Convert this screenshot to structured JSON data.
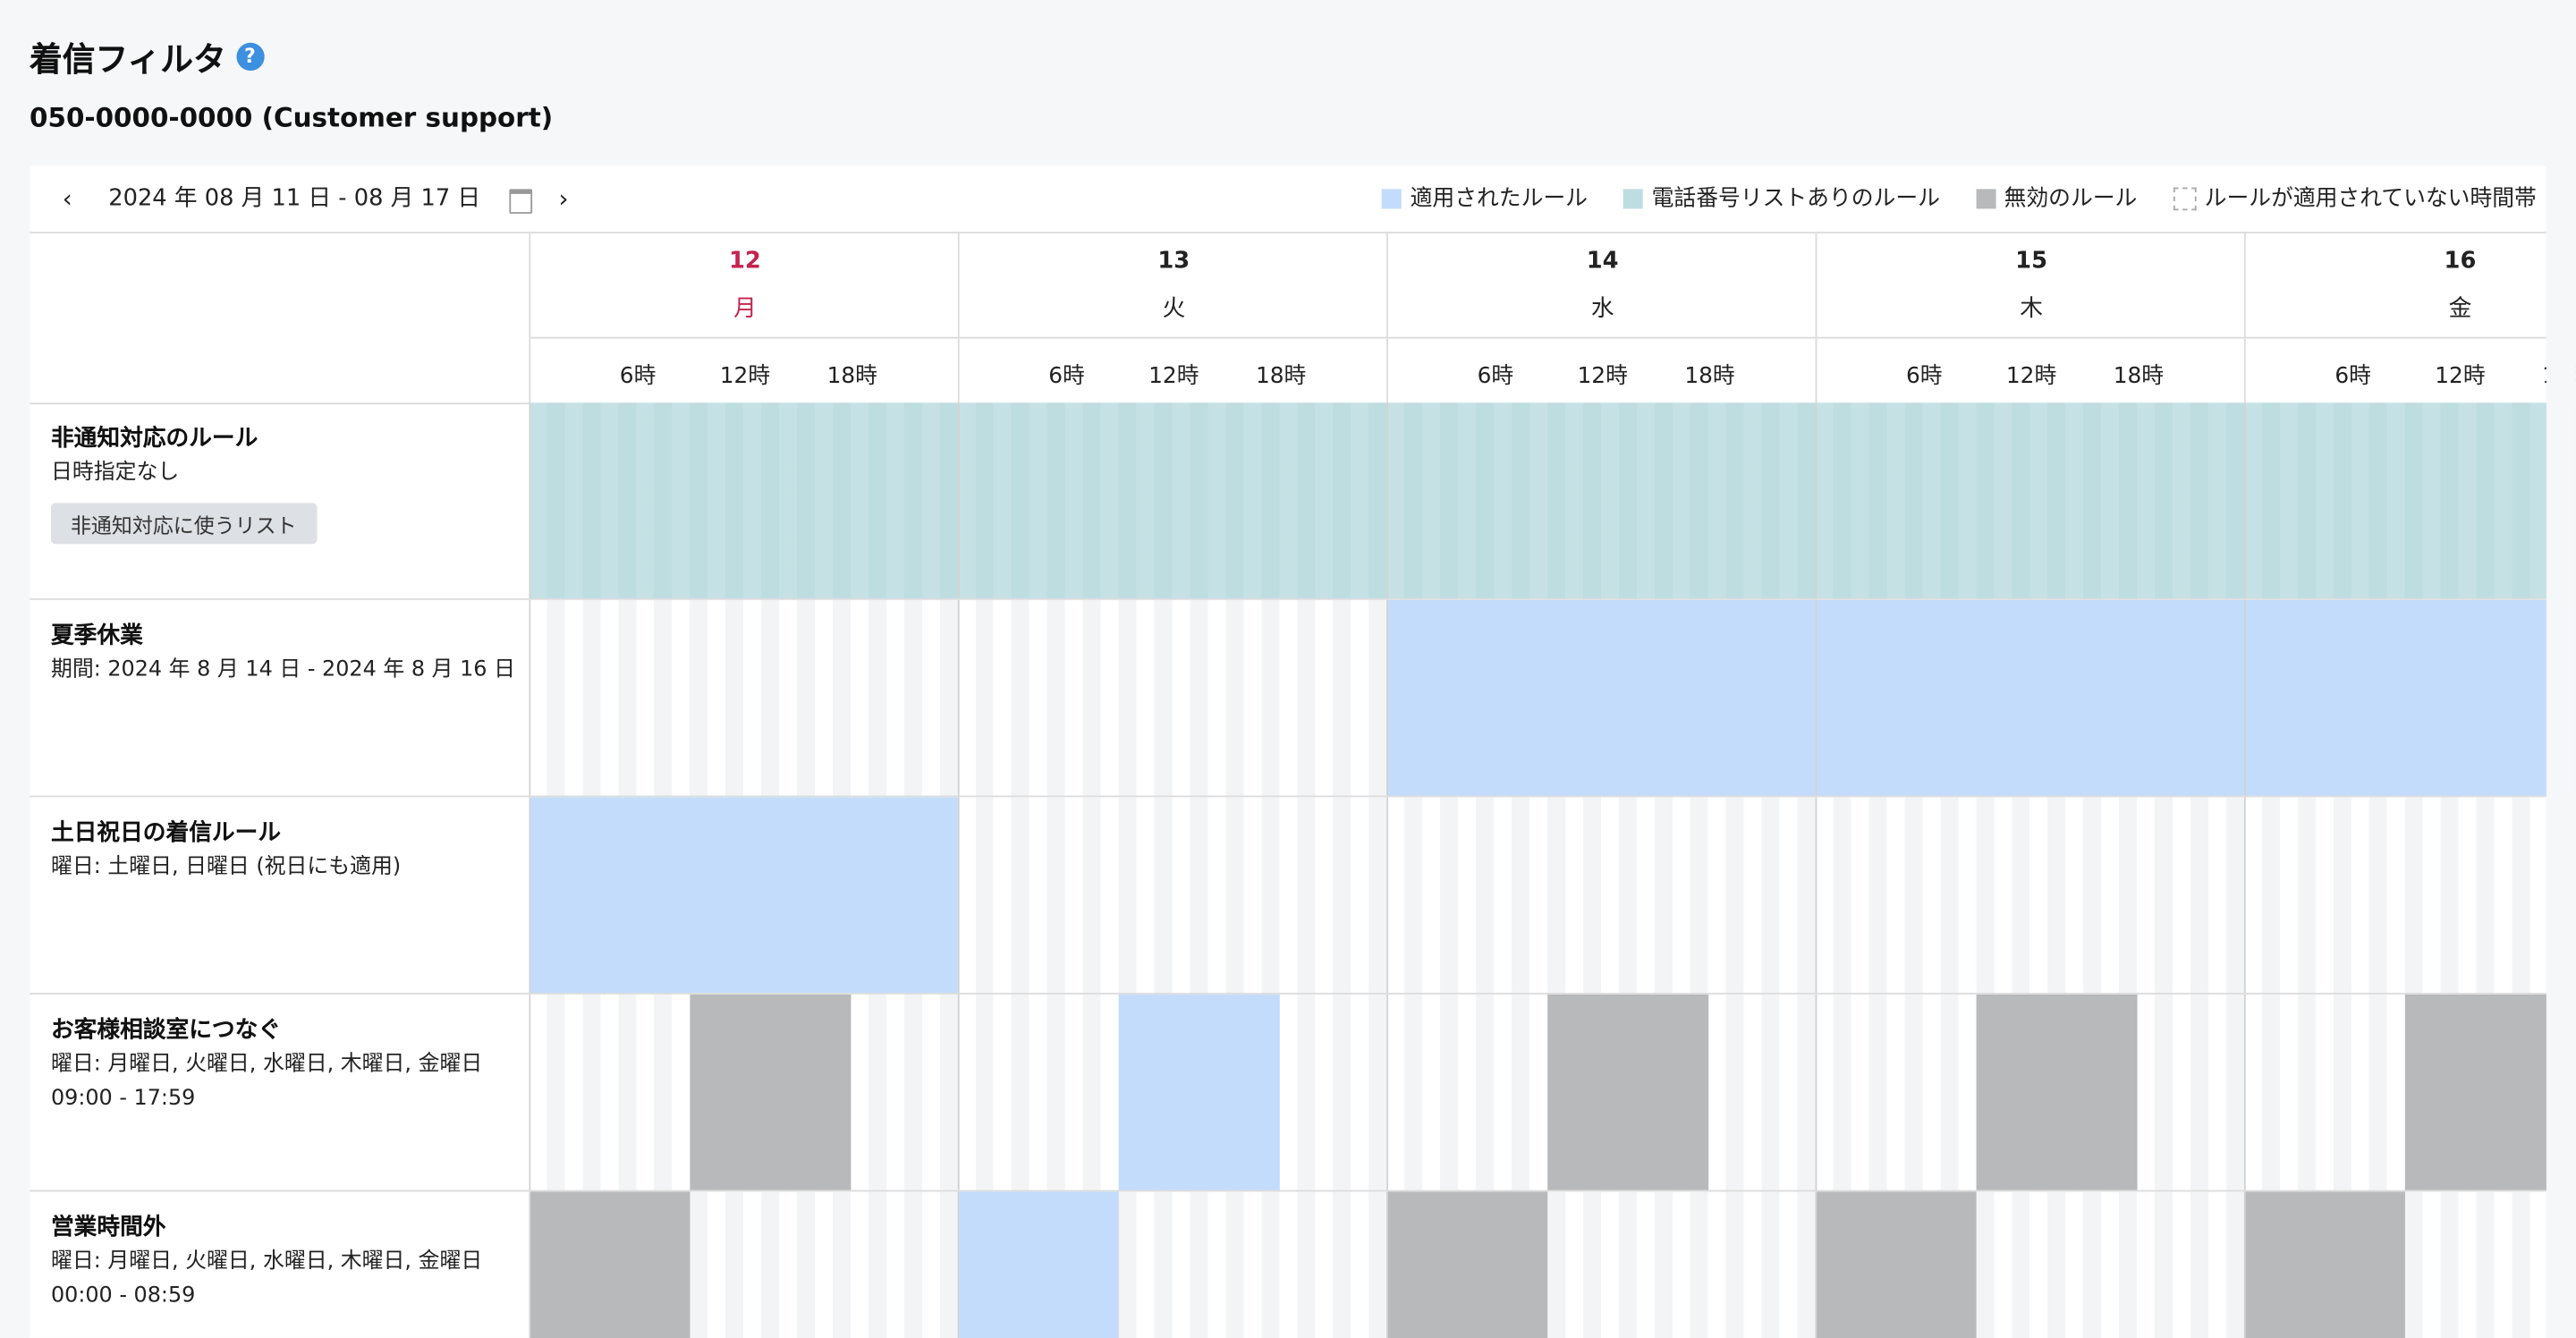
{
  "page": {
    "title": "着信フィルタ",
    "help_icon": "help-circle-icon",
    "phone_line": "050-0000-0000 (Customer support)"
  },
  "toolbar": {
    "prev_label": "‹",
    "next_label": "›",
    "date_range": "2024 年 08 月 11 日 - 08 月 17 日",
    "calendar_icon": "calendar-icon"
  },
  "legend": [
    {
      "label": "適用されたルール",
      "color": "#c3dcfb",
      "kind": "applied"
    },
    {
      "label": "電話番号リストありのルール",
      "color": "#bedde1",
      "kind": "list"
    },
    {
      "label": "無効のルール",
      "color": "#b8b9bb",
      "kind": "disabled"
    },
    {
      "label": "ルールが適用されていない時間帯",
      "color": "#ffffff",
      "kind": "none"
    }
  ],
  "hour_labels": [
    "6時",
    "12時",
    "18時"
  ],
  "days": [
    {
      "num": "12",
      "weekday": "月",
      "highlight": true
    },
    {
      "num": "13",
      "weekday": "火",
      "highlight": false
    },
    {
      "num": "14",
      "weekday": "水",
      "highlight": false
    },
    {
      "num": "15",
      "weekday": "木",
      "highlight": false
    },
    {
      "num": "16",
      "weekday": "金",
      "highlight": false
    }
  ],
  "colors": {
    "highlight_day": "#c4234f",
    "applied": "#c3dcfb",
    "list": "#bedde1",
    "disabled": "#b8b9bb"
  },
  "rules": [
    {
      "name": "非通知対応のルール",
      "details": [
        "日時指定なし"
      ],
      "tag": "非通知対応に使うリスト",
      "blocks": [
        {
          "day": 0,
          "from": 0,
          "to": 24,
          "type": "list"
        },
        {
          "day": 1,
          "from": 0,
          "to": 24,
          "type": "list"
        },
        {
          "day": 2,
          "from": 0,
          "to": 24,
          "type": "list"
        },
        {
          "day": 3,
          "from": 0,
          "to": 24,
          "type": "list"
        },
        {
          "day": 4,
          "from": 0,
          "to": 24,
          "type": "list"
        }
      ]
    },
    {
      "name": "夏季休業",
      "details": [
        "期間: 2024 年 8 月 14 日 - 2024 年 8 月 16 日"
      ],
      "blocks": [
        {
          "day": 2,
          "from": 0,
          "to": 24,
          "type": "applied"
        },
        {
          "day": 3,
          "from": 0,
          "to": 24,
          "type": "applied"
        },
        {
          "day": 4,
          "from": 0,
          "to": 24,
          "type": "applied"
        }
      ]
    },
    {
      "name": "土日祝日の着信ルール",
      "details": [
        "曜日: 土曜日, 日曜日 (祝日にも適用)"
      ],
      "blocks": [
        {
          "day": 0,
          "from": 0,
          "to": 24,
          "type": "applied"
        }
      ]
    },
    {
      "name": "お客様相談室につなぐ",
      "details": [
        "曜日: 月曜日, 火曜日, 水曜日, 木曜日, 金曜日",
        "09:00 - 17:59"
      ],
      "blocks": [
        {
          "day": 0,
          "from": 9,
          "to": 18,
          "type": "disabled"
        },
        {
          "day": 1,
          "from": 9,
          "to": 18,
          "type": "applied"
        },
        {
          "day": 2,
          "from": 9,
          "to": 18,
          "type": "disabled"
        },
        {
          "day": 3,
          "from": 9,
          "to": 18,
          "type": "disabled"
        },
        {
          "day": 4,
          "from": 9,
          "to": 18,
          "type": "disabled"
        }
      ]
    },
    {
      "name": "営業時間外",
      "details": [
        "曜日: 月曜日, 火曜日, 水曜日, 木曜日, 金曜日",
        "00:00 - 08:59"
      ],
      "blocks": [
        {
          "day": 0,
          "from": 0,
          "to": 9,
          "type": "disabled"
        },
        {
          "day": 1,
          "from": 0,
          "to": 9,
          "type": "applied"
        },
        {
          "day": 2,
          "from": 0,
          "to": 9,
          "type": "disabled"
        },
        {
          "day": 3,
          "from": 0,
          "to": 9,
          "type": "disabled"
        },
        {
          "day": 4,
          "from": 0,
          "to": 9,
          "type": "disabled"
        }
      ]
    }
  ]
}
